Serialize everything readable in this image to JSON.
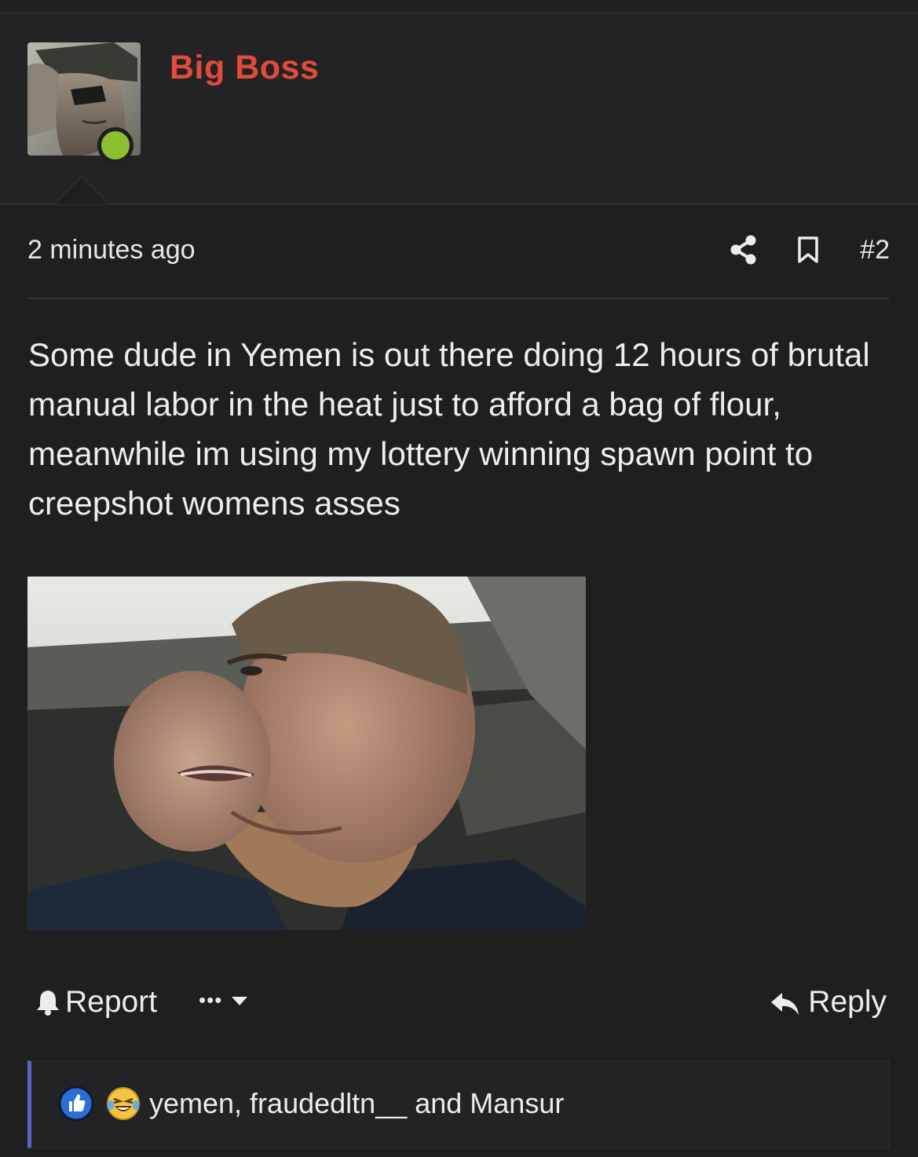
{
  "post": {
    "author": "Big Boss",
    "timestamp": "2 minutes ago",
    "post_number": "#2",
    "body": "Some dude in Yemen is out there doing 12 hours of brutal manual labor in the heat just to afford a bag of flour, meanwhile im using my lottery winning spawn point to creepshot womens asses"
  },
  "actions": {
    "report_label": "Report",
    "more_label": "•••",
    "reply_label": "Reply"
  },
  "reactions": {
    "users_text": "yemen, fraudedltn__ and Mansur",
    "icons": [
      "like-icon",
      "laugh-cry-icon"
    ]
  },
  "colors": {
    "author": "#e04b3c",
    "online": "#8bbf2f",
    "reaction_accent": "#5f5fc4",
    "background": "#1f1f20"
  },
  "icons": {
    "share": "share-icon",
    "bookmark": "bookmark-icon",
    "report": "bell-icon",
    "more": "chevron-down-icon",
    "reply": "reply-arrow-icon"
  }
}
